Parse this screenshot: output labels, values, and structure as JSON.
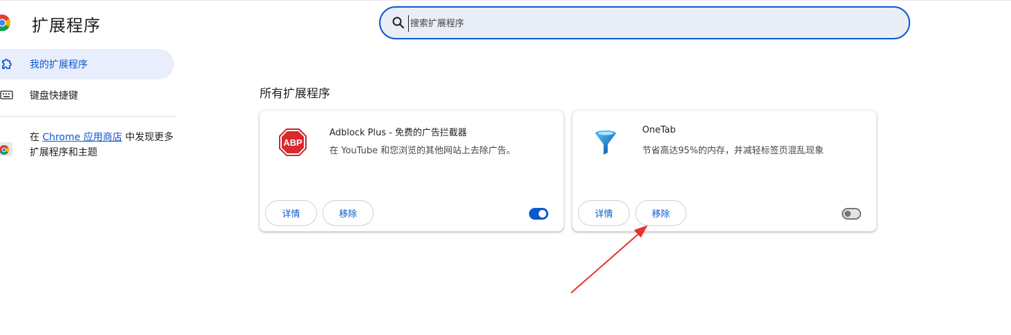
{
  "header": {
    "title": "扩展程序"
  },
  "search": {
    "placeholder": "搜索扩展程序"
  },
  "sidebar": {
    "items": [
      {
        "label": "我的扩展程序",
        "icon": "extensions-puzzle-icon",
        "active": true
      },
      {
        "label": "键盘快捷键",
        "icon": "keyboard-icon",
        "active": false
      }
    ],
    "store_prefix": "在 ",
    "store_link": "Chrome 应用商店",
    "store_suffix": " 中发现更多扩展程序和主题"
  },
  "main": {
    "section_title": "所有扩展程序",
    "extensions": [
      {
        "name": "Adblock Plus - 免费的广告拦截器",
        "description": "在 YouTube 和您浏览的其他网站上去除广告。",
        "icon": "abp-stop-sign-icon",
        "icon_text": "ABP",
        "details_label": "详情",
        "remove_label": "移除",
        "enabled": true
      },
      {
        "name": "OneTab",
        "description": "节省高达95%的内存，并减轻标签页混乱现象",
        "icon": "onetab-funnel-icon",
        "details_label": "详情",
        "remove_label": "移除",
        "enabled": false
      }
    ]
  },
  "annotation": {
    "type": "red-arrow",
    "color": "#e8312f"
  },
  "colors": {
    "accent": "#0b57d0",
    "active_nav_bg": "#e8eefb",
    "search_bg": "#e9eef6"
  }
}
